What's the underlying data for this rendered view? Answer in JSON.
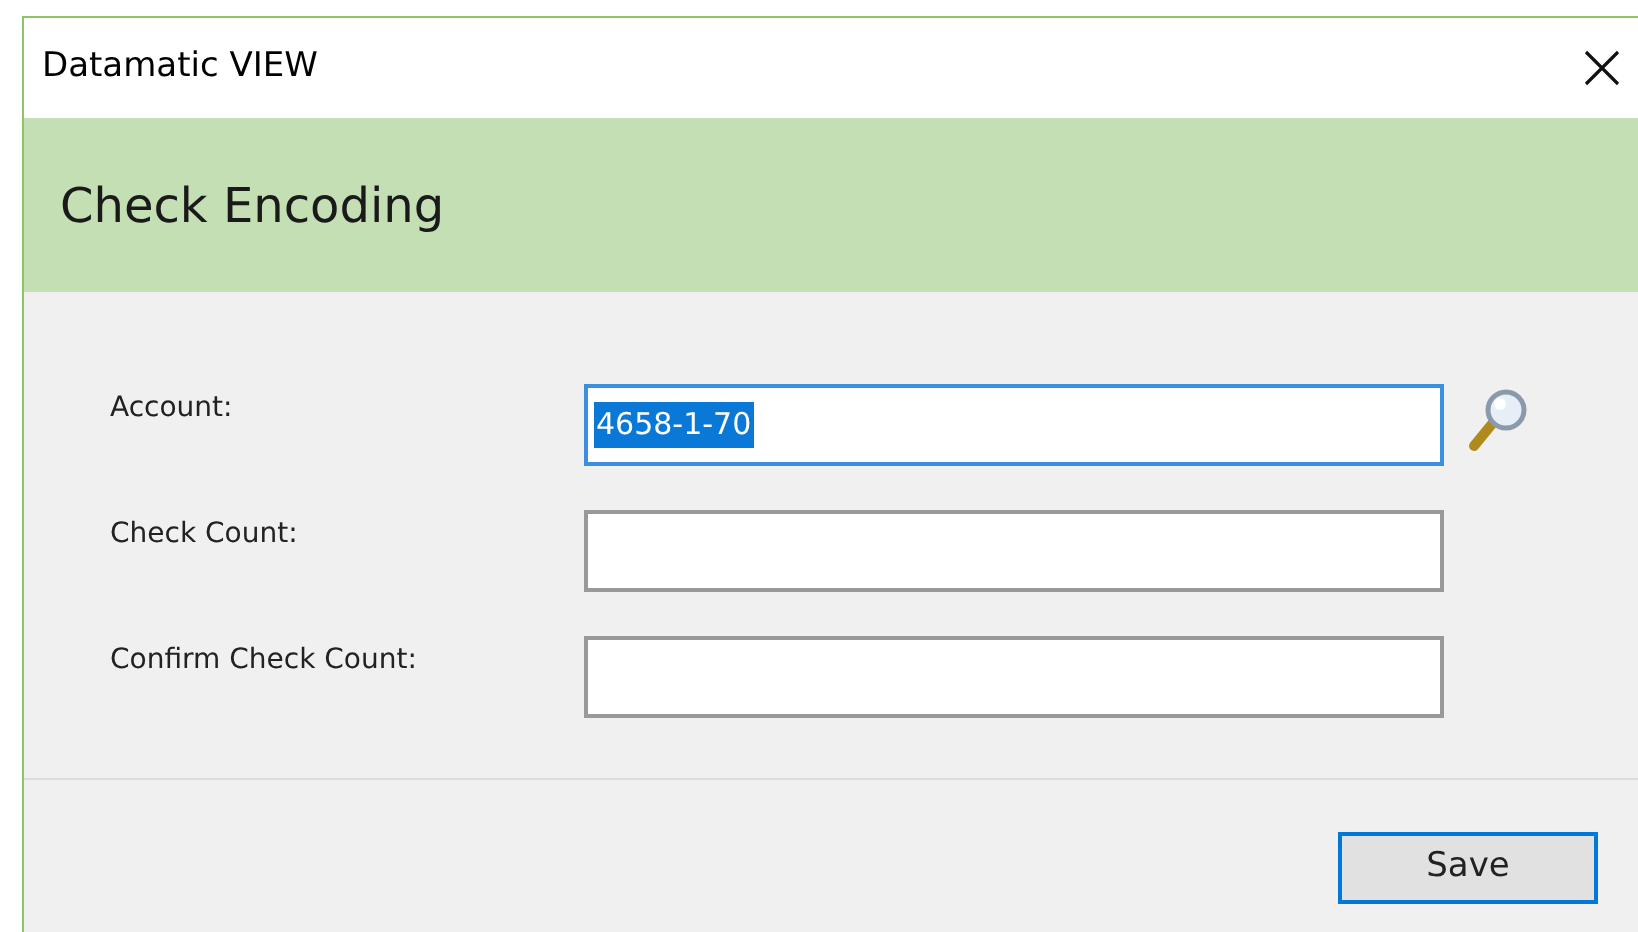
{
  "window": {
    "title": "Datamatic VIEW"
  },
  "header": {
    "title": "Check Encoding"
  },
  "fields": [
    {
      "label": "Account:",
      "value": "4658-1-70",
      "focused": true,
      "text_selected": true,
      "kind": "lookup"
    },
    {
      "label": "Check Count:",
      "focused": false,
      "kind": "plain"
    },
    {
      "label": "Confirm Check Count:",
      "focused": false,
      "kind": "plain"
    }
  ],
  "buttons": [
    {
      "label": "Save",
      "focused": true
    }
  ]
}
